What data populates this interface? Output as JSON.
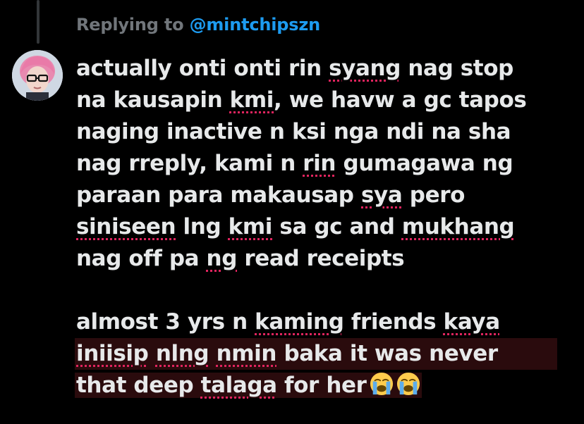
{
  "reply_header": {
    "prefix": "Replying to",
    "mention": "@mintchipszn"
  },
  "tweet": {
    "paragraph1": [
      {
        "segments": [
          {
            "text": "actually onti onti rin "
          },
          {
            "text": "syang",
            "spell": true
          },
          {
            "text": " nag stop"
          }
        ]
      },
      {
        "segments": [
          {
            "text": "na kausapin "
          },
          {
            "text": "kmi",
            "spell": true
          },
          {
            "text": ", we havw a gc tapos"
          }
        ]
      },
      {
        "segments": [
          {
            "text": "naging inactive n ksi nga ndi na sha"
          }
        ]
      },
      {
        "segments": [
          {
            "text": "nag rreply, kami n "
          },
          {
            "text": "rin",
            "spell": true
          },
          {
            "text": " gumagawa ng"
          }
        ]
      },
      {
        "segments": [
          {
            "text": "paraan para makausap "
          },
          {
            "text": "sya",
            "spell": true
          },
          {
            "text": " pero"
          }
        ]
      },
      {
        "segments": [
          {
            "text": "siniseen",
            "spell": true
          },
          {
            "text": " lng "
          },
          {
            "text": "kmi",
            "spell": true
          },
          {
            "text": " sa gc and "
          },
          {
            "text": "mukhang",
            "spell": true
          }
        ]
      },
      {
        "segments": [
          {
            "text": "nag off pa "
          },
          {
            "text": "ng",
            "spell": true
          },
          {
            "text": " read receipts"
          }
        ]
      }
    ],
    "paragraph2": [
      {
        "segments": [
          {
            "text": "almost 3 yrs n "
          },
          {
            "text": "kaming",
            "spell": true
          },
          {
            "text": " friends "
          },
          {
            "text": "kaya",
            "spell": true
          }
        ]
      },
      {
        "segments": [
          {
            "text": "iniisip",
            "spell": true
          },
          {
            "text": " "
          },
          {
            "text": "nlng",
            "spell": true
          },
          {
            "text": " "
          },
          {
            "text": "nmin",
            "spell": true
          },
          {
            "text": " baka it was never"
          }
        ]
      },
      {
        "segments": [
          {
            "text": "that deep "
          },
          {
            "text": "talaga",
            "spell": true
          },
          {
            "text": " for her"
          }
        ]
      }
    ],
    "emojis": [
      "loudly-crying-face",
      "loudly-crying-face"
    ]
  },
  "colors": {
    "background": "#000000",
    "text": "#e7e9ea",
    "muted": "#71767b",
    "mention": "#1d9bf0",
    "spellcheck": "#e0245e",
    "highlight": "#2a0b0d"
  }
}
